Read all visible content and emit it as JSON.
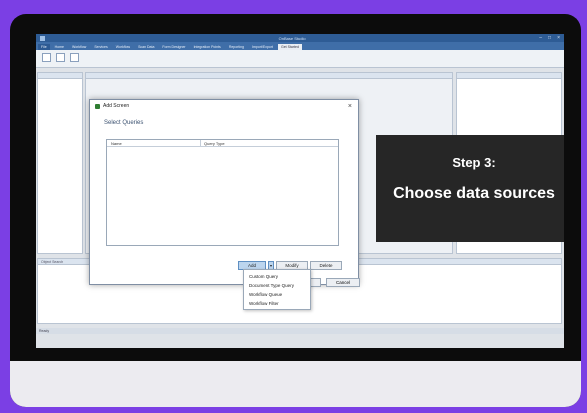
{
  "app": {
    "window_title": "OnBase Studio",
    "ribbon_tabs": [
      "File",
      "Home",
      "Workflow",
      "Services",
      "Workflow",
      "Scan Data",
      "Form Designer",
      "Integration Points",
      "Reporting",
      "Import/Export",
      "Get Started"
    ],
    "status_text": "Ready",
    "lower_tabs": [
      "Object Search"
    ]
  },
  "dialog": {
    "title": "Add Screen",
    "section": "Select Queries",
    "columns": [
      "Name",
      "Query Type"
    ],
    "buttons": {
      "add": "Add",
      "modify": "Modify",
      "delete": "Delete",
      "cancel": "Cancel"
    }
  },
  "dropdown": {
    "items": [
      "Custom Query",
      "Document Type Query",
      "Workflow Queue",
      "Workflow Filter"
    ]
  },
  "overlay": {
    "step": "Step 3:",
    "caption": "Choose data sources"
  },
  "colors": {
    "background": "#7b3fe4",
    "frame": "#0c0c0c",
    "accent": "#3f6ea8"
  }
}
